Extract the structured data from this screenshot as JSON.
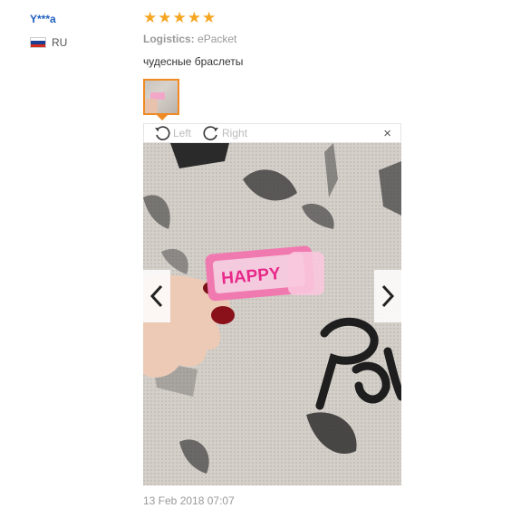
{
  "reviewer": {
    "name": "Y***a",
    "country": "RU"
  },
  "review": {
    "rating": 5,
    "logistics_label": "Logistics:",
    "logistics_value": "ePacket",
    "text": "чудесные браслеты",
    "date": "13 Feb 2018 07:07"
  },
  "viewer": {
    "rotate_left_label": "Left",
    "rotate_right_label": "Right",
    "close_symbol": "×"
  },
  "photo": {
    "band_text": "HAPPY"
  },
  "colors": {
    "star": "#f5a623",
    "accent": "#f08a24",
    "name": "#1f5fbf"
  }
}
